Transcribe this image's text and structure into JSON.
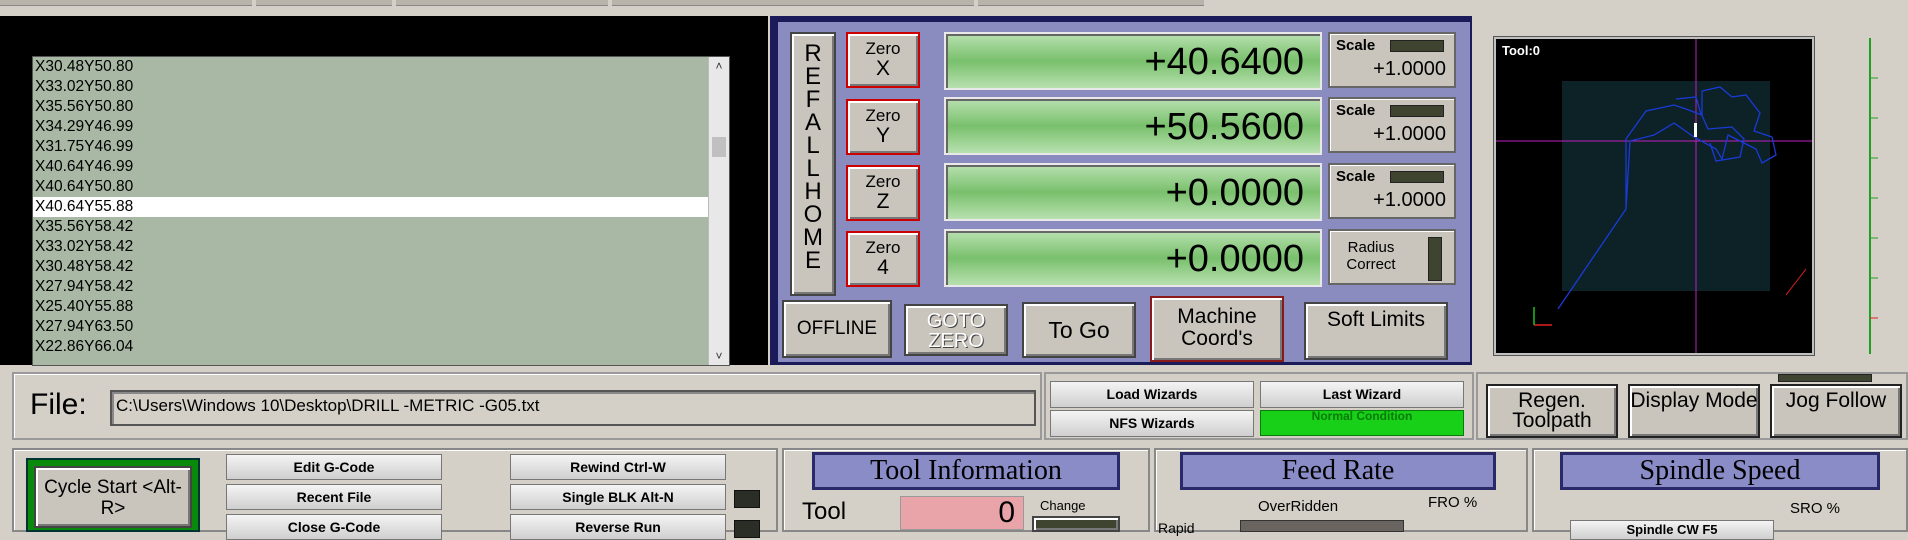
{
  "gcode": {
    "lines": [
      "X30.48Y50.80",
      "X33.02Y50.80",
      "X35.56Y50.80",
      "X34.29Y46.99",
      "X31.75Y46.99",
      "X40.64Y46.99",
      "X40.64Y50.80",
      "X40.64Y55.88",
      "X35.56Y58.42",
      "X33.02Y58.42",
      "X30.48Y58.42",
      "X27.94Y58.42",
      "X25.40Y55.88",
      "X27.94Y63.50",
      "X22.86Y66.04"
    ],
    "selected_index": 7,
    "scroll_up_icon": "chevron-up-icon",
    "scroll_down_icon": "chevron-down-icon"
  },
  "dro": {
    "ref_all_home": "REF ALL HOME",
    "axes": [
      {
        "zero_label": "Zero",
        "axis": "X",
        "value": "+40.6400",
        "scale_label": "Scale",
        "scale_value": "+1.0000"
      },
      {
        "zero_label": "Zero",
        "axis": "Y",
        "value": "+50.5600",
        "scale_label": "Scale",
        "scale_value": "+1.0000"
      },
      {
        "zero_label": "Zero",
        "axis": "Z",
        "value": "+0.0000",
        "scale_label": "Scale",
        "scale_value": "+1.0000"
      },
      {
        "zero_label": "Zero",
        "axis": "4",
        "value": "+0.0000"
      }
    ],
    "radius_correct": "Radius Correct",
    "offline": "OFFLINE",
    "goto_zero": "GOTO ZERO",
    "to_go": "To Go",
    "machine_coords": "Machine Coord's",
    "soft_limits": "Soft Limits"
  },
  "toolpath": {
    "tool_label": "Tool:0",
    "path_color": "#1a3ad8",
    "crosshair_color": "#c020c0"
  },
  "file": {
    "label": "File:",
    "path": "C:\\Users\\Windows 10\\Desktop\\DRILL   -METRIC   -G05.txt"
  },
  "wizards": {
    "load": "Load Wizards",
    "last": "Last Wizard",
    "nfs": "NFS Wizards",
    "normal_condition": "Normal Condition"
  },
  "toolpath_buttons": {
    "regen": "Regen. Toolpath",
    "display_mode": "Display Mode",
    "jog_follow": "Jog Follow"
  },
  "controls": {
    "cycle_start": "Cycle Start <Alt-R>",
    "edit_gcode": "Edit G-Code",
    "recent_file": "Recent File",
    "close_gcode": "Close G-Code",
    "rewind": "Rewind Ctrl-W",
    "single_blk": "Single BLK Alt-N",
    "reverse_run": "Reverse Run"
  },
  "tool_info": {
    "title": "Tool Information",
    "tool_label": "Tool",
    "tool_value": "0",
    "change": "Change"
  },
  "feed_rate": {
    "title": "Feed Rate",
    "overridden": "OverRidden",
    "fro": "FRO %",
    "rapid": "Rapid"
  },
  "spindle": {
    "title": "Spindle Speed",
    "sro": "SRO %",
    "spindle_cw": "Spindle CW F5"
  },
  "colors": {
    "dro_green": "#79c06c",
    "panel_navy": "#1b1b5a",
    "accent_red": "#cc0000",
    "cycle_green": "#0a8a0a"
  }
}
